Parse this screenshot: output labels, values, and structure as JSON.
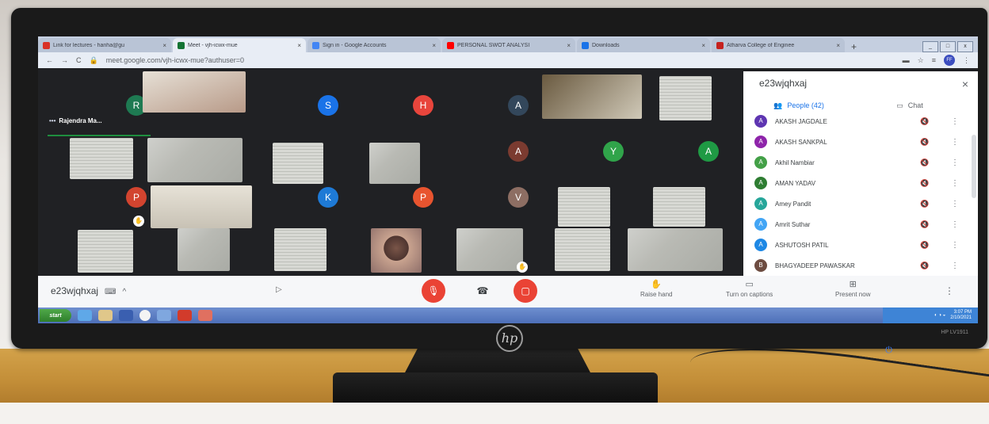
{
  "browser": {
    "tabs": [
      {
        "title": "Link for lectures - hanha@gu",
        "color": "#d93025",
        "active": false
      },
      {
        "title": "Meet - vjh-icwx-mue",
        "color": "#137333",
        "active": true
      },
      {
        "title": "Sign in - Google Accounts",
        "color": "#4285f4",
        "active": false
      },
      {
        "title": "PERSONAL SWOT ANALYSI",
        "color": "#ff0000",
        "active": false
      },
      {
        "title": "Downloads",
        "color": "#1a73e8",
        "active": false
      },
      {
        "title": "Atharva College of Enginee",
        "color": "#c5221f",
        "active": false
      }
    ],
    "new_tab": "+",
    "back": "←",
    "forward": "→",
    "reload": "C",
    "url": "meet.google.com/vjh-icwx-mue?authuser=0",
    "profile_initials": "FF"
  },
  "meet": {
    "speaker_name": "Rajendra Ma...",
    "speaker_dots": "•••",
    "avatars": [
      {
        "letter": "R",
        "color": "#1e7a52"
      },
      {
        "letter": "S",
        "color": "#1a73e8"
      },
      {
        "letter": "H",
        "color": "#e8453c"
      },
      {
        "letter": "A",
        "color": "#33475b"
      },
      {
        "letter": "A",
        "color": "#7b3b30"
      },
      {
        "letter": "Y",
        "color": "#30a44a"
      },
      {
        "letter": "A",
        "color": "#1f9a44"
      },
      {
        "letter": "P",
        "color": "#d2442f"
      },
      {
        "letter": "K",
        "color": "#1e7ad6"
      },
      {
        "letter": "P",
        "color": "#e8542f"
      },
      {
        "letter": "V",
        "color": "#8d6e63"
      }
    ],
    "meeting_code": "e23wjqhxaj",
    "caret_up": "^",
    "controls": {
      "raise_hand": "Raise hand",
      "captions": "Turn on captions",
      "present": "Present now",
      "more": "⋮"
    }
  },
  "panel": {
    "title": "e23wjqhxaj",
    "close": "×",
    "people_tab": "People (42)",
    "chat_tab": "Chat",
    "people": [
      {
        "name": "AKASH JAGDALE",
        "initial": "A",
        "color": "#5e35b1"
      },
      {
        "name": "AKASH SANKPAL",
        "initial": "A",
        "color": "#8e24aa"
      },
      {
        "name": "Akhil Nambiar",
        "initial": "A",
        "color": "#43a047"
      },
      {
        "name": "AMAN YADAV",
        "initial": "A",
        "color": "#2e7d32"
      },
      {
        "name": "Amey Pandit",
        "initial": "A",
        "color": "#26a69a"
      },
      {
        "name": "Amrit Suthar",
        "initial": "A",
        "color": "#42a5f5"
      },
      {
        "name": "ASHUTOSH PATIL",
        "initial": "A",
        "color": "#1e88e5"
      },
      {
        "name": "BHAGYADEEP PAWASKAR",
        "initial": "B",
        "color": "#6d4c41"
      }
    ]
  },
  "taskbar": {
    "start": "start",
    "time": "3:07 PM",
    "date": "2/10/2021"
  },
  "monitor": {
    "brand": "hp",
    "model": "HP LV1911"
  }
}
